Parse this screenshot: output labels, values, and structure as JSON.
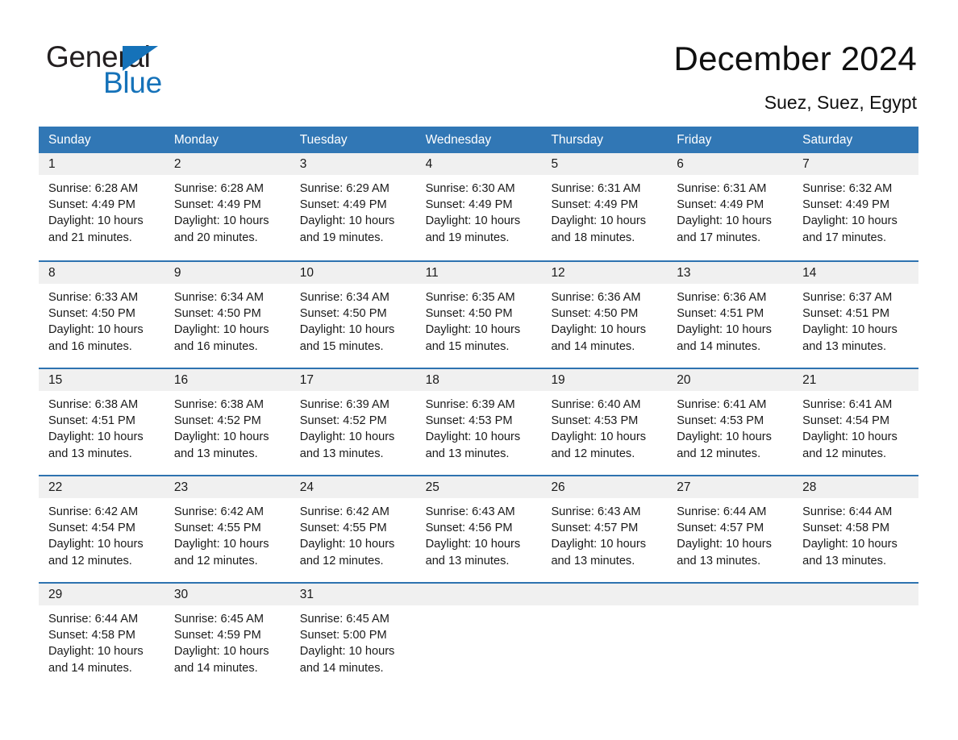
{
  "logo": {
    "word_one": "General",
    "word_two": "Blue",
    "triangle_icon": "triangle-icon",
    "brand_color": "#1572b9"
  },
  "header": {
    "title": "December 2024",
    "location": "Suez, Suez, Egypt"
  },
  "colors": {
    "header_row_bg": "#3177b5",
    "week_divider": "#2e73b0",
    "day_head_bg": "#f0f0f0",
    "text": "#1a1a1a"
  },
  "calendar": {
    "weekdays": [
      "Sunday",
      "Monday",
      "Tuesday",
      "Wednesday",
      "Thursday",
      "Friday",
      "Saturday"
    ],
    "weeks": [
      [
        {
          "day": "1",
          "sunrise": "Sunrise: 6:28 AM",
          "sunset": "Sunset: 4:49 PM",
          "daylight1": "Daylight: 10 hours",
          "daylight2": "and 21 minutes."
        },
        {
          "day": "2",
          "sunrise": "Sunrise: 6:28 AM",
          "sunset": "Sunset: 4:49 PM",
          "daylight1": "Daylight: 10 hours",
          "daylight2": "and 20 minutes."
        },
        {
          "day": "3",
          "sunrise": "Sunrise: 6:29 AM",
          "sunset": "Sunset: 4:49 PM",
          "daylight1": "Daylight: 10 hours",
          "daylight2": "and 19 minutes."
        },
        {
          "day": "4",
          "sunrise": "Sunrise: 6:30 AM",
          "sunset": "Sunset: 4:49 PM",
          "daylight1": "Daylight: 10 hours",
          "daylight2": "and 19 minutes."
        },
        {
          "day": "5",
          "sunrise": "Sunrise: 6:31 AM",
          "sunset": "Sunset: 4:49 PM",
          "daylight1": "Daylight: 10 hours",
          "daylight2": "and 18 minutes."
        },
        {
          "day": "6",
          "sunrise": "Sunrise: 6:31 AM",
          "sunset": "Sunset: 4:49 PM",
          "daylight1": "Daylight: 10 hours",
          "daylight2": "and 17 minutes."
        },
        {
          "day": "7",
          "sunrise": "Sunrise: 6:32 AM",
          "sunset": "Sunset: 4:49 PM",
          "daylight1": "Daylight: 10 hours",
          "daylight2": "and 17 minutes."
        }
      ],
      [
        {
          "day": "8",
          "sunrise": "Sunrise: 6:33 AM",
          "sunset": "Sunset: 4:50 PM",
          "daylight1": "Daylight: 10 hours",
          "daylight2": "and 16 minutes."
        },
        {
          "day": "9",
          "sunrise": "Sunrise: 6:34 AM",
          "sunset": "Sunset: 4:50 PM",
          "daylight1": "Daylight: 10 hours",
          "daylight2": "and 16 minutes."
        },
        {
          "day": "10",
          "sunrise": "Sunrise: 6:34 AM",
          "sunset": "Sunset: 4:50 PM",
          "daylight1": "Daylight: 10 hours",
          "daylight2": "and 15 minutes."
        },
        {
          "day": "11",
          "sunrise": "Sunrise: 6:35 AM",
          "sunset": "Sunset: 4:50 PM",
          "daylight1": "Daylight: 10 hours",
          "daylight2": "and 15 minutes."
        },
        {
          "day": "12",
          "sunrise": "Sunrise: 6:36 AM",
          "sunset": "Sunset: 4:50 PM",
          "daylight1": "Daylight: 10 hours",
          "daylight2": "and 14 minutes."
        },
        {
          "day": "13",
          "sunrise": "Sunrise: 6:36 AM",
          "sunset": "Sunset: 4:51 PM",
          "daylight1": "Daylight: 10 hours",
          "daylight2": "and 14 minutes."
        },
        {
          "day": "14",
          "sunrise": "Sunrise: 6:37 AM",
          "sunset": "Sunset: 4:51 PM",
          "daylight1": "Daylight: 10 hours",
          "daylight2": "and 13 minutes."
        }
      ],
      [
        {
          "day": "15",
          "sunrise": "Sunrise: 6:38 AM",
          "sunset": "Sunset: 4:51 PM",
          "daylight1": "Daylight: 10 hours",
          "daylight2": "and 13 minutes."
        },
        {
          "day": "16",
          "sunrise": "Sunrise: 6:38 AM",
          "sunset": "Sunset: 4:52 PM",
          "daylight1": "Daylight: 10 hours",
          "daylight2": "and 13 minutes."
        },
        {
          "day": "17",
          "sunrise": "Sunrise: 6:39 AM",
          "sunset": "Sunset: 4:52 PM",
          "daylight1": "Daylight: 10 hours",
          "daylight2": "and 13 minutes."
        },
        {
          "day": "18",
          "sunrise": "Sunrise: 6:39 AM",
          "sunset": "Sunset: 4:53 PM",
          "daylight1": "Daylight: 10 hours",
          "daylight2": "and 13 minutes."
        },
        {
          "day": "19",
          "sunrise": "Sunrise: 6:40 AM",
          "sunset": "Sunset: 4:53 PM",
          "daylight1": "Daylight: 10 hours",
          "daylight2": "and 12 minutes."
        },
        {
          "day": "20",
          "sunrise": "Sunrise: 6:41 AM",
          "sunset": "Sunset: 4:53 PM",
          "daylight1": "Daylight: 10 hours",
          "daylight2": "and 12 minutes."
        },
        {
          "day": "21",
          "sunrise": "Sunrise: 6:41 AM",
          "sunset": "Sunset: 4:54 PM",
          "daylight1": "Daylight: 10 hours",
          "daylight2": "and 12 minutes."
        }
      ],
      [
        {
          "day": "22",
          "sunrise": "Sunrise: 6:42 AM",
          "sunset": "Sunset: 4:54 PM",
          "daylight1": "Daylight: 10 hours",
          "daylight2": "and 12 minutes."
        },
        {
          "day": "23",
          "sunrise": "Sunrise: 6:42 AM",
          "sunset": "Sunset: 4:55 PM",
          "daylight1": "Daylight: 10 hours",
          "daylight2": "and 12 minutes."
        },
        {
          "day": "24",
          "sunrise": "Sunrise: 6:42 AM",
          "sunset": "Sunset: 4:55 PM",
          "daylight1": "Daylight: 10 hours",
          "daylight2": "and 12 minutes."
        },
        {
          "day": "25",
          "sunrise": "Sunrise: 6:43 AM",
          "sunset": "Sunset: 4:56 PM",
          "daylight1": "Daylight: 10 hours",
          "daylight2": "and 13 minutes."
        },
        {
          "day": "26",
          "sunrise": "Sunrise: 6:43 AM",
          "sunset": "Sunset: 4:57 PM",
          "daylight1": "Daylight: 10 hours",
          "daylight2": "and 13 minutes."
        },
        {
          "day": "27",
          "sunrise": "Sunrise: 6:44 AM",
          "sunset": "Sunset: 4:57 PM",
          "daylight1": "Daylight: 10 hours",
          "daylight2": "and 13 minutes."
        },
        {
          "day": "28",
          "sunrise": "Sunrise: 6:44 AM",
          "sunset": "Sunset: 4:58 PM",
          "daylight1": "Daylight: 10 hours",
          "daylight2": "and 13 minutes."
        }
      ],
      [
        {
          "day": "29",
          "sunrise": "Sunrise: 6:44 AM",
          "sunset": "Sunset: 4:58 PM",
          "daylight1": "Daylight: 10 hours",
          "daylight2": "and 14 minutes."
        },
        {
          "day": "30",
          "sunrise": "Sunrise: 6:45 AM",
          "sunset": "Sunset: 4:59 PM",
          "daylight1": "Daylight: 10 hours",
          "daylight2": "and 14 minutes."
        },
        {
          "day": "31",
          "sunrise": "Sunrise: 6:45 AM",
          "sunset": "Sunset: 5:00 PM",
          "daylight1": "Daylight: 10 hours",
          "daylight2": "and 14 minutes."
        },
        {
          "day": "",
          "sunrise": "",
          "sunset": "",
          "daylight1": "",
          "daylight2": ""
        },
        {
          "day": "",
          "sunrise": "",
          "sunset": "",
          "daylight1": "",
          "daylight2": ""
        },
        {
          "day": "",
          "sunrise": "",
          "sunset": "",
          "daylight1": "",
          "daylight2": ""
        },
        {
          "day": "",
          "sunrise": "",
          "sunset": "",
          "daylight1": "",
          "daylight2": ""
        }
      ]
    ]
  }
}
